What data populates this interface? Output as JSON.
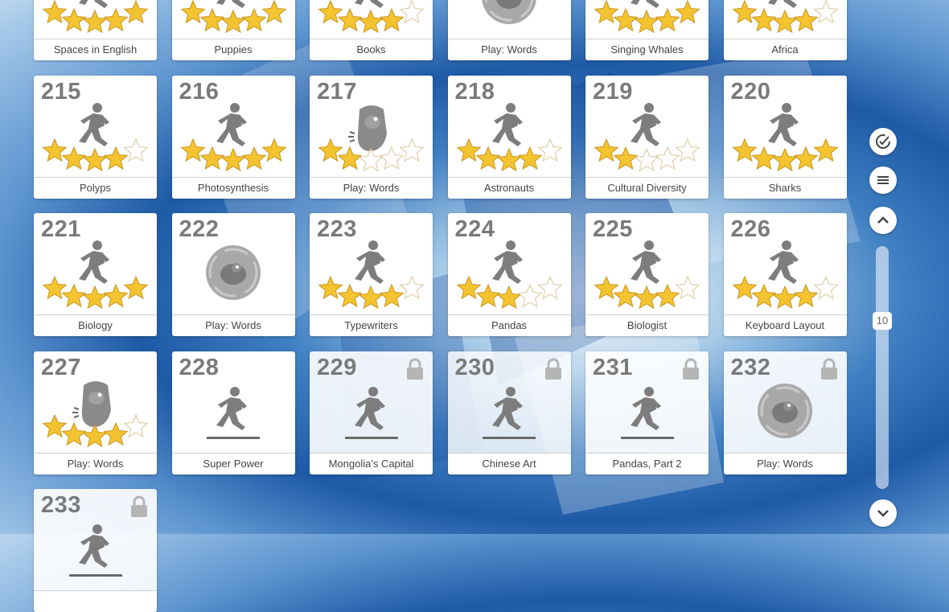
{
  "lessons": [
    {
      "num": "",
      "title": "Spaces in English",
      "kind": "runner",
      "stars": 5,
      "locked": false
    },
    {
      "num": "",
      "title": "Puppies",
      "kind": "runner",
      "stars": 5,
      "locked": false
    },
    {
      "num": "",
      "title": "Books",
      "kind": "runner",
      "stars": 4,
      "locked": false
    },
    {
      "num": "",
      "title": "Play: Words",
      "kind": "game",
      "stars": 0,
      "locked": false
    },
    {
      "num": "",
      "title": "Singing Whales",
      "kind": "runner",
      "stars": 5,
      "locked": false
    },
    {
      "num": "",
      "title": "Africa",
      "kind": "runner",
      "stars": 4,
      "locked": false
    },
    {
      "num": "215",
      "title": "Polyps",
      "kind": "runner",
      "stars": 4,
      "locked": false
    },
    {
      "num": "216",
      "title": "Photosynthesis",
      "kind": "runner",
      "stars": 5,
      "locked": false
    },
    {
      "num": "217",
      "title": "Play: Words",
      "kind": "monster",
      "stars": 2,
      "locked": false
    },
    {
      "num": "218",
      "title": "Astronauts",
      "kind": "runner",
      "stars": 4,
      "locked": false
    },
    {
      "num": "219",
      "title": "Cultural Diversity",
      "kind": "runner",
      "stars": 2,
      "locked": false
    },
    {
      "num": "220",
      "title": "Sharks",
      "kind": "runner",
      "stars": 5,
      "locked": false
    },
    {
      "num": "221",
      "title": "Biology",
      "kind": "runner",
      "stars": 5,
      "locked": false
    },
    {
      "num": "222",
      "title": "Play: Words",
      "kind": "game",
      "stars": 0,
      "locked": false
    },
    {
      "num": "223",
      "title": "Typewriters",
      "kind": "runner",
      "stars": 4,
      "locked": false
    },
    {
      "num": "224",
      "title": "Pandas",
      "kind": "runner",
      "stars": 3,
      "locked": false
    },
    {
      "num": "225",
      "title": "Biologist",
      "kind": "runner",
      "stars": 4,
      "locked": false
    },
    {
      "num": "226",
      "title": "Keyboard Layout",
      "kind": "runner",
      "stars": 4,
      "locked": false
    },
    {
      "num": "227",
      "title": "Play: Words",
      "kind": "monster",
      "stars": 4,
      "locked": false
    },
    {
      "num": "228",
      "title": "Super Power",
      "kind": "runner-line",
      "stars": 0,
      "locked": false
    },
    {
      "num": "229",
      "title": "Mongolia's Capital",
      "kind": "runner-line",
      "stars": 0,
      "locked": true
    },
    {
      "num": "230",
      "title": "Chinese Art",
      "kind": "runner-line",
      "stars": 0,
      "locked": true
    },
    {
      "num": "231",
      "title": "Pandas, Part 2",
      "kind": "runner-line",
      "stars": 0,
      "locked": true
    },
    {
      "num": "232",
      "title": "Play: Words",
      "kind": "game",
      "stars": 0,
      "locked": true
    },
    {
      "num": "233",
      "title": "",
      "kind": "runner-line",
      "stars": 0,
      "locked": true
    }
  ],
  "sidebar": {
    "page_number": "10",
    "icons": [
      "check-circle-icon",
      "list-icon",
      "chevron-up-icon",
      "chevron-down-icon"
    ]
  },
  "colors": {
    "star": "#f4c430",
    "figure": "#7d7d7d",
    "number": "#7a7a7a"
  }
}
